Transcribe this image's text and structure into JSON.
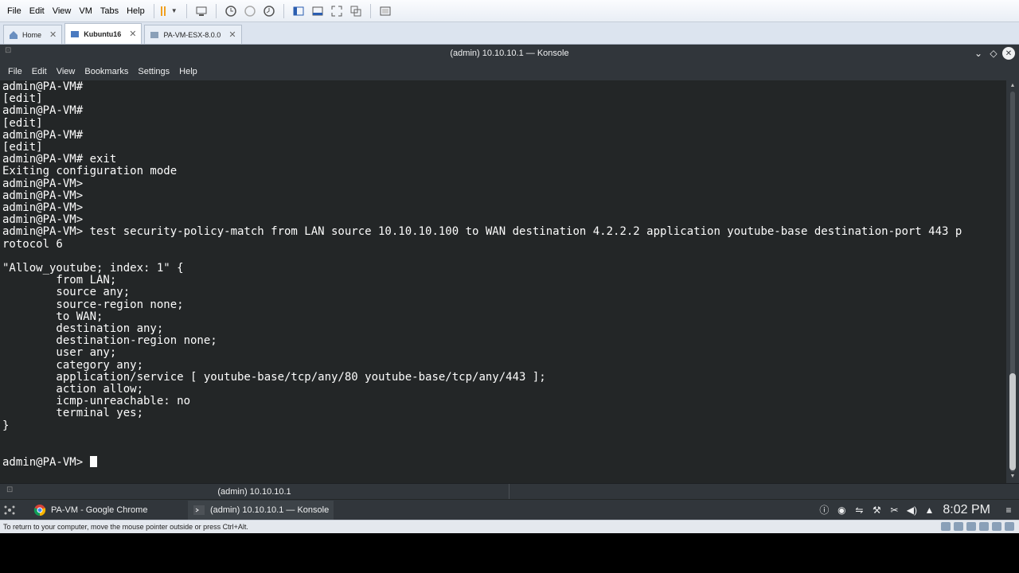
{
  "vmware": {
    "menu": [
      "File",
      "Edit",
      "View",
      "VM",
      "Tabs",
      "Help"
    ],
    "tabs": [
      {
        "label": "Home",
        "active": false
      },
      {
        "label": "Kubuntu16",
        "active": true
      },
      {
        "label": "PA-VM-ESX-8.0.0",
        "active": false
      }
    ],
    "status_text": "To return to your computer, move the mouse pointer outside or press Ctrl+Alt."
  },
  "konsole": {
    "title": "(admin) 10.10.10.1 — Konsole",
    "menu": [
      "File",
      "Edit",
      "View",
      "Bookmarks",
      "Settings",
      "Help"
    ],
    "tab_label": "(admin) 10.10.10.1",
    "terminal_text": "admin@PA-VM#\n[edit]\nadmin@PA-VM#\n[edit]\nadmin@PA-VM#\n[edit]\nadmin@PA-VM# exit\nExiting configuration mode\nadmin@PA-VM>\nadmin@PA-VM>\nadmin@PA-VM>\nadmin@PA-VM>\nadmin@PA-VM> test security-policy-match from LAN source 10.10.10.100 to WAN destination 4.2.2.2 application youtube-base destination-port 443 p\nrotocol 6\n\n\"Allow_youtube; index: 1\" {\n        from LAN;\n        source any;\n        source-region none;\n        to WAN;\n        destination any;\n        destination-region none;\n        user any;\n        category any;\n        application/service [ youtube-base/tcp/any/80 youtube-base/tcp/any/443 ];\n        action allow;\n        icmp-unreachable: no\n        terminal yes;\n}\n\n\n",
    "prompt": "admin@PA-VM> "
  },
  "panel": {
    "tasks": [
      {
        "label": "PA-VM - Google Chrome",
        "icon": "chrome-icon"
      },
      {
        "label": "(admin) 10.10.10.1 — Konsole",
        "icon": "terminal-icon"
      }
    ],
    "clock": "8:02 PM"
  },
  "colors": {
    "terminal_bg": "#232627",
    "terminal_fg": "#fcfcfc",
    "window_chrome": "#31363b"
  }
}
